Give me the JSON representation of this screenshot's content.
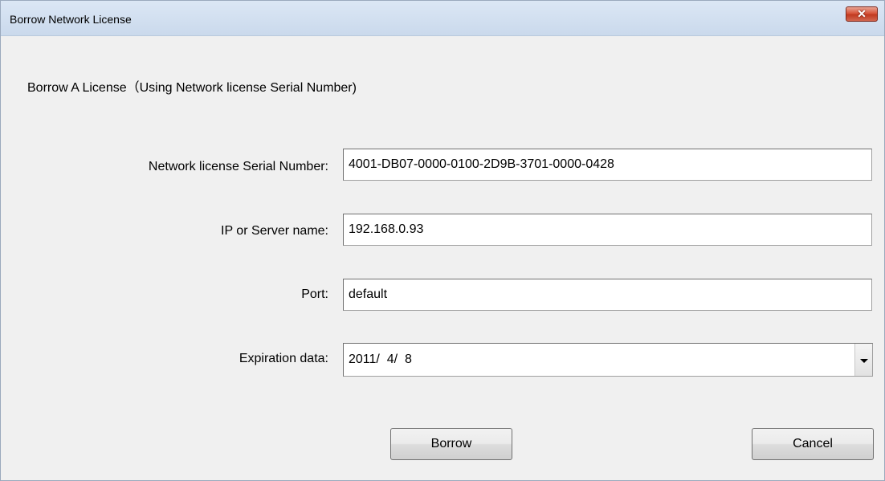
{
  "window": {
    "title": "Borrow Network License",
    "close_symbol": "✕"
  },
  "dialog": {
    "heading": "Borrow A License（Using Network license Serial Number)",
    "fields": {
      "serial": {
        "label": "Network license Serial Number:",
        "value": "4001-DB07-0000-0100-2D9B-3701-0000-0428"
      },
      "server": {
        "label": "IP or Server name:",
        "value": "192.168.0.93"
      },
      "port": {
        "label": "Port:",
        "value": "default"
      },
      "expiration": {
        "label": "Expiration data:",
        "value": "2011/  4/  8"
      }
    },
    "buttons": {
      "borrow": "Borrow",
      "cancel": "Cancel"
    }
  },
  "colors": {
    "titlebar": "#cad9ec",
    "close_button": "#c13a20",
    "dialog_background": "#f0f0f0"
  },
  "icons": {
    "close": "close-icon",
    "dropdown": "chevron-down-icon"
  }
}
